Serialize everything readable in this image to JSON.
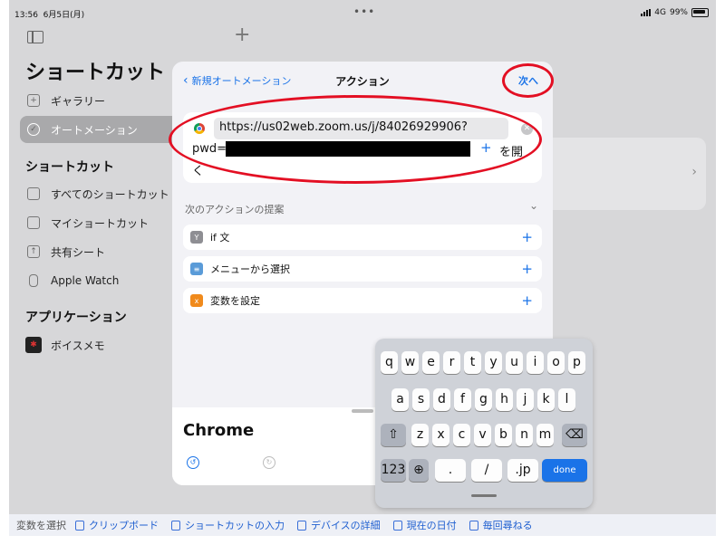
{
  "status": {
    "time": "13:56",
    "date": "6月5日(月)",
    "network": "4G",
    "battery": "99%"
  },
  "sidebar": {
    "title": "ショートカット",
    "top_items": [
      {
        "label": "ギャラリー",
        "icon": "gallery-icon"
      },
      {
        "label": "オートメーション",
        "icon": "clock-icon",
        "selected": true
      }
    ],
    "section_shortcuts": "ショートカット",
    "shortcut_items": [
      {
        "label": "すべてのショートカット",
        "icon": "stack-icon"
      },
      {
        "label": "マイショートカット",
        "icon": "my-shortcuts-icon"
      },
      {
        "label": "共有シート",
        "icon": "share-icon"
      },
      {
        "label": "Apple Watch",
        "icon": "watch-icon"
      }
    ],
    "section_apps": "アプリケーション",
    "app_items": [
      {
        "label": "ボイスメモ",
        "icon": "voice-memo-icon"
      }
    ]
  },
  "modal": {
    "back_label": "新規オートメーション",
    "title": "アクション",
    "next_label": "次へ",
    "action": {
      "url": "https://us02web.zoom.us/j/84026929906?",
      "pwd_prefix": "pwd=",
      "open_suffix_1": "を開",
      "open_suffix_2": "く"
    },
    "suggestions_header": "次のアクションの提案",
    "suggestions": [
      {
        "label": "if 文",
        "color": "#8e8e93",
        "glyph": "Y"
      },
      {
        "label": "メニューから選択",
        "color": "#5a9bd8",
        "glyph": "≡"
      },
      {
        "label": "変数を設定",
        "color": "#f08a1c",
        "glyph": "x"
      }
    ],
    "lower_title": "Chrome"
  },
  "keyboard": {
    "row1": [
      "q",
      "w",
      "e",
      "r",
      "t",
      "y",
      "u",
      "i",
      "o",
      "p"
    ],
    "row2": [
      "a",
      "s",
      "d",
      "f",
      "g",
      "h",
      "j",
      "k",
      "l"
    ],
    "row3": [
      "z",
      "x",
      "c",
      "v",
      "b",
      "n",
      "m"
    ],
    "key_123": "123",
    "key_dot": ".",
    "key_slash": "/",
    "key_jp": ".jp",
    "key_done": "done"
  },
  "bottombar": {
    "label": "変数を選択",
    "items": [
      "クリップボード",
      "ショートカットの入力",
      "デバイスの詳細",
      "現在の日付",
      "毎回尋ねる"
    ]
  },
  "colors": {
    "accent": "#1a73e8",
    "annotation": "#e30f23",
    "selected_row": "#a9a9ab"
  }
}
